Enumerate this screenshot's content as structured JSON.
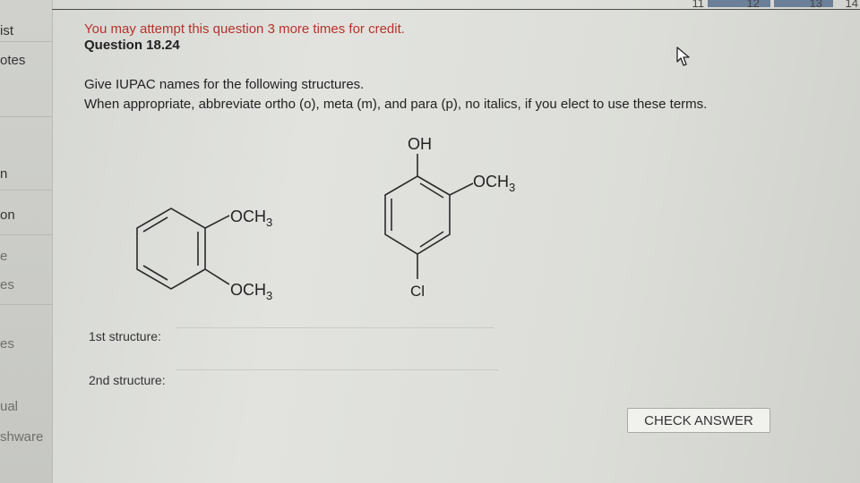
{
  "sidebar": {
    "items": [
      {
        "label": "ist"
      },
      {
        "label": "otes"
      },
      {
        "label": "n"
      },
      {
        "label": "on"
      },
      {
        "label": "e"
      },
      {
        "label": "es"
      },
      {
        "label": "es"
      },
      {
        "label": "ual"
      },
      {
        "label": "shware"
      }
    ]
  },
  "pager": {
    "pages": [
      "11",
      "12",
      "13",
      "14"
    ]
  },
  "question": {
    "attempt_notice": "You may attempt this question 3 more times for credit.",
    "number": "Question 18.24",
    "instruction_1": "Give IUPAC names for the following structures.",
    "instruction_2": "When appropriate, abbreviate ortho (o), meta (m), and para (p), no italics, if you elect to use these terms."
  },
  "structures": {
    "s1_sub_top": "OCH",
    "s1_sub_bottom": "OCH",
    "s2_sub_top": "OH",
    "s2_sub_right": "OCH",
    "s2_sub_bottom": "Cl",
    "subscript": "3"
  },
  "answers": {
    "label_1": "1st structure:",
    "value_1": "",
    "label_2": "2nd structure:",
    "value_2": ""
  },
  "check_button_label": "CHECK ANSWER",
  "colors": {
    "attempt_text": "#b5332a",
    "page_tab": "#6b7f99"
  },
  "icons": {
    "cursor": "mouse-pointer-icon"
  }
}
